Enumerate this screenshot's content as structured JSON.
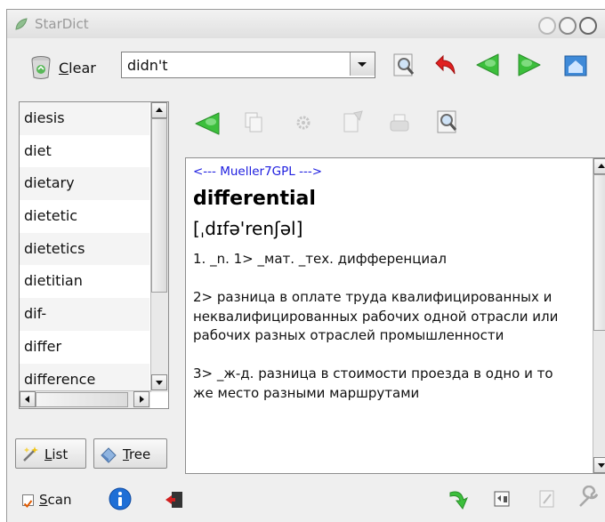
{
  "window": {
    "title": "StarDict"
  },
  "toolbar": {
    "clear_label": "Clear",
    "clear_mnemonic": "C",
    "clear_rest": "lear",
    "search_value": "didn't"
  },
  "word_list": {
    "items": [
      "diesis",
      "diet",
      "dietary",
      "dietetic",
      "dietetics",
      "dietitian",
      "dif-",
      "differ",
      "difference"
    ]
  },
  "mode_tabs": {
    "list_mnemonic": "L",
    "list_rest": "ist",
    "tree_mnemonic": "T",
    "tree_rest": "ree"
  },
  "article": {
    "dict_name": "<--- Mueller7GPL --->",
    "headword": "differential",
    "transcription": "[ˌdɪfə'renʃəl]",
    "definition": "1. _n. 1> _мат. _тех. дифференциал\n\n2> разница в оплате труда квалифицированных и неквалифицированных рабочих одной отрасли или рабочих разных отраслей промышленности\n\n3> _ж-д. разница в стоимости проезда в одно и то же место разными маршрутами"
  },
  "statusbar": {
    "scan_mnemonic": "S",
    "scan_rest": "can",
    "scan_checked": true
  },
  "colors": {
    "accent_green": "#3cbf3c",
    "link_blue": "#2020e0",
    "info_blue": "#1f6fd6"
  }
}
